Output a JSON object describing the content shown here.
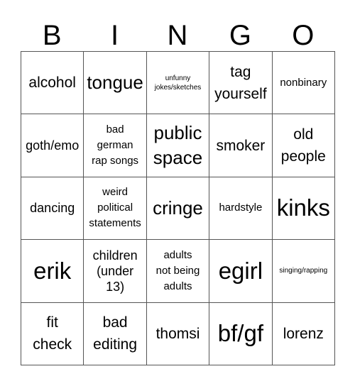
{
  "header": {
    "letters": [
      "B",
      "I",
      "N",
      "G",
      "O"
    ]
  },
  "board": {
    "cells": [
      {
        "text": "alcohol",
        "size": "l"
      },
      {
        "text": "tongue",
        "size": "xl"
      },
      {
        "text": "unfunny\njokes/sketches",
        "size": "xs"
      },
      {
        "text": "tag\nyourself",
        "size": "l"
      },
      {
        "text": "nonbinary",
        "size": "s"
      },
      {
        "text": "goth/emo",
        "size": "m"
      },
      {
        "text": "bad\ngerman\nrap songs",
        "size": "s"
      },
      {
        "text": "public\nspace",
        "size": "xl"
      },
      {
        "text": "smoker",
        "size": "l"
      },
      {
        "text": "old\npeople",
        "size": "l"
      },
      {
        "text": "dancing",
        "size": "m"
      },
      {
        "text": "weird\npolitical\nstatements",
        "size": "s"
      },
      {
        "text": "cringe",
        "size": "xl"
      },
      {
        "text": "hardstyle",
        "size": "s"
      },
      {
        "text": "kinks",
        "size": "xxl"
      },
      {
        "text": "erik",
        "size": "xxl"
      },
      {
        "text": "children\n(under\n13)",
        "size": "m"
      },
      {
        "text": "adults\nnot being\nadults",
        "size": "s"
      },
      {
        "text": "egirl",
        "size": "xxl"
      },
      {
        "text": "singing/rapping",
        "size": "xs"
      },
      {
        "text": "fit\ncheck",
        "size": "l"
      },
      {
        "text": "bad\nediting",
        "size": "l"
      },
      {
        "text": "thomsi",
        "size": "l"
      },
      {
        "text": "bf/gf",
        "size": "xxl"
      },
      {
        "text": "lorenz",
        "size": "l"
      }
    ]
  }
}
